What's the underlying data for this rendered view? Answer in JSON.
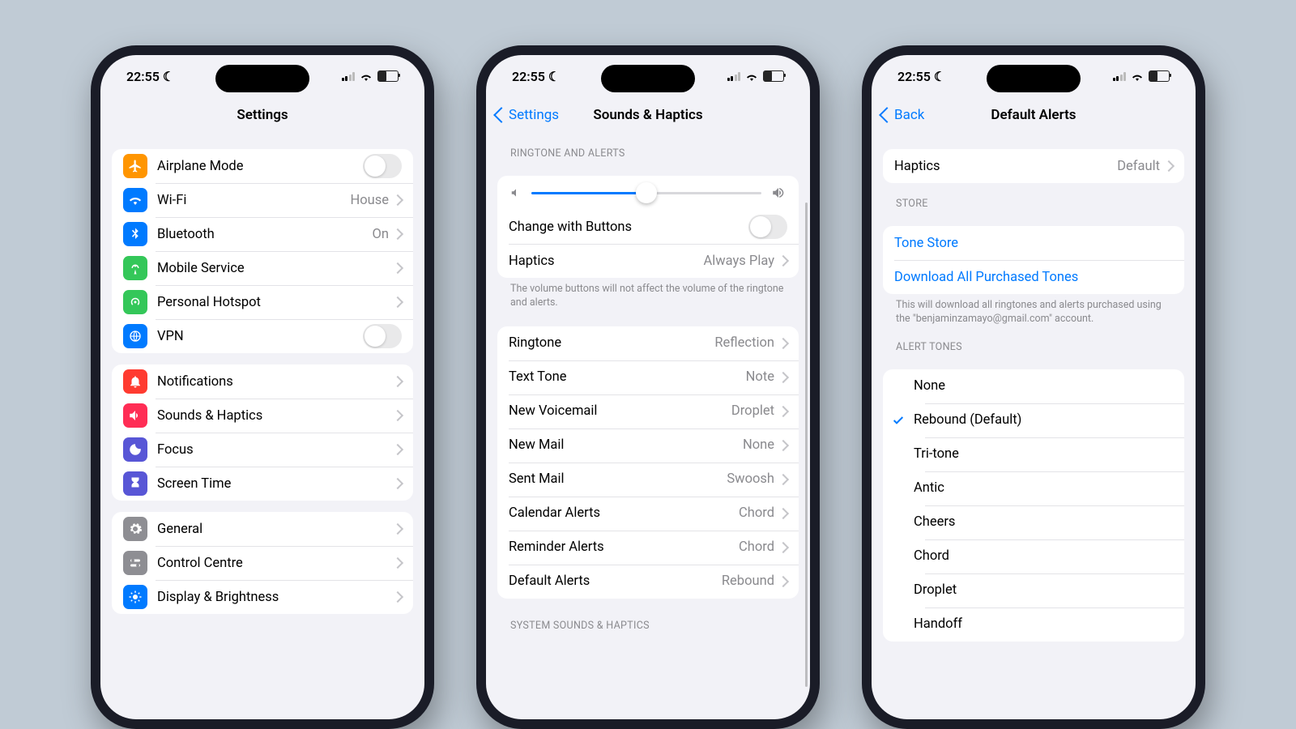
{
  "status": {
    "time": "22:55"
  },
  "p1": {
    "title": "Settings",
    "g1": [
      {
        "label": "Airplane Mode",
        "value": "",
        "chev": false,
        "toggle": true,
        "color": "#ff9500",
        "icon": "airplane"
      },
      {
        "label": "Wi-Fi",
        "value": "House",
        "chev": true,
        "color": "#007aff",
        "icon": "wifi"
      },
      {
        "label": "Bluetooth",
        "value": "On",
        "chev": true,
        "color": "#007aff",
        "icon": "bluetooth"
      },
      {
        "label": "Mobile Service",
        "value": "",
        "chev": true,
        "color": "#34c759",
        "icon": "antenna"
      },
      {
        "label": "Personal Hotspot",
        "value": "",
        "chev": true,
        "color": "#34c759",
        "icon": "hotspot"
      },
      {
        "label": "VPN",
        "value": "",
        "chev": false,
        "toggle": true,
        "color": "#007aff",
        "icon": "vpn"
      }
    ],
    "g2": [
      {
        "label": "Notifications",
        "color": "#ff3b30",
        "icon": "bell"
      },
      {
        "label": "Sounds & Haptics",
        "color": "#ff2d55",
        "icon": "speaker"
      },
      {
        "label": "Focus",
        "color": "#5856d6",
        "icon": "moon"
      },
      {
        "label": "Screen Time",
        "color": "#5856d6",
        "icon": "hourglass"
      }
    ],
    "g3": [
      {
        "label": "General",
        "color": "#8e8e93",
        "icon": "gear"
      },
      {
        "label": "Control Centre",
        "color": "#8e8e93",
        "icon": "switches"
      },
      {
        "label": "Display & Brightness",
        "color": "#007aff",
        "icon": "sun"
      }
    ]
  },
  "p2": {
    "back": "Settings",
    "title": "Sounds & Haptics",
    "s1_header": "Ringtone and Alerts",
    "s1_change": "Change with Buttons",
    "s1_haptics_label": "Haptics",
    "s1_haptics_value": "Always Play",
    "s1_footer": "The volume buttons will not affect the volume of the ringtone and alerts.",
    "s2": [
      {
        "label": "Ringtone",
        "value": "Reflection"
      },
      {
        "label": "Text Tone",
        "value": "Note"
      },
      {
        "label": "New Voicemail",
        "value": "Droplet"
      },
      {
        "label": "New Mail",
        "value": "None"
      },
      {
        "label": "Sent Mail",
        "value": "Swoosh"
      },
      {
        "label": "Calendar Alerts",
        "value": "Chord"
      },
      {
        "label": "Reminder Alerts",
        "value": "Chord"
      },
      {
        "label": "Default Alerts",
        "value": "Rebound"
      }
    ],
    "s3_header": "System Sounds & Haptics"
  },
  "p3": {
    "back": "Back",
    "title": "Default Alerts",
    "haptics_label": "Haptics",
    "haptics_value": "Default",
    "store_header": "Store",
    "store_items": [
      "Tone Store",
      "Download All Purchased Tones"
    ],
    "store_footer": "This will download all ringtones and alerts purchased using the \"benjaminzamayo@gmail.com\" account.",
    "tones_header": "Alert Tones",
    "none_label": "None",
    "tones": [
      {
        "label": "Rebound (Default)",
        "sel": true
      },
      {
        "label": "Tri-tone"
      },
      {
        "label": "Antic"
      },
      {
        "label": "Cheers"
      },
      {
        "label": "Chord"
      },
      {
        "label": "Droplet"
      },
      {
        "label": "Handoff"
      }
    ]
  }
}
